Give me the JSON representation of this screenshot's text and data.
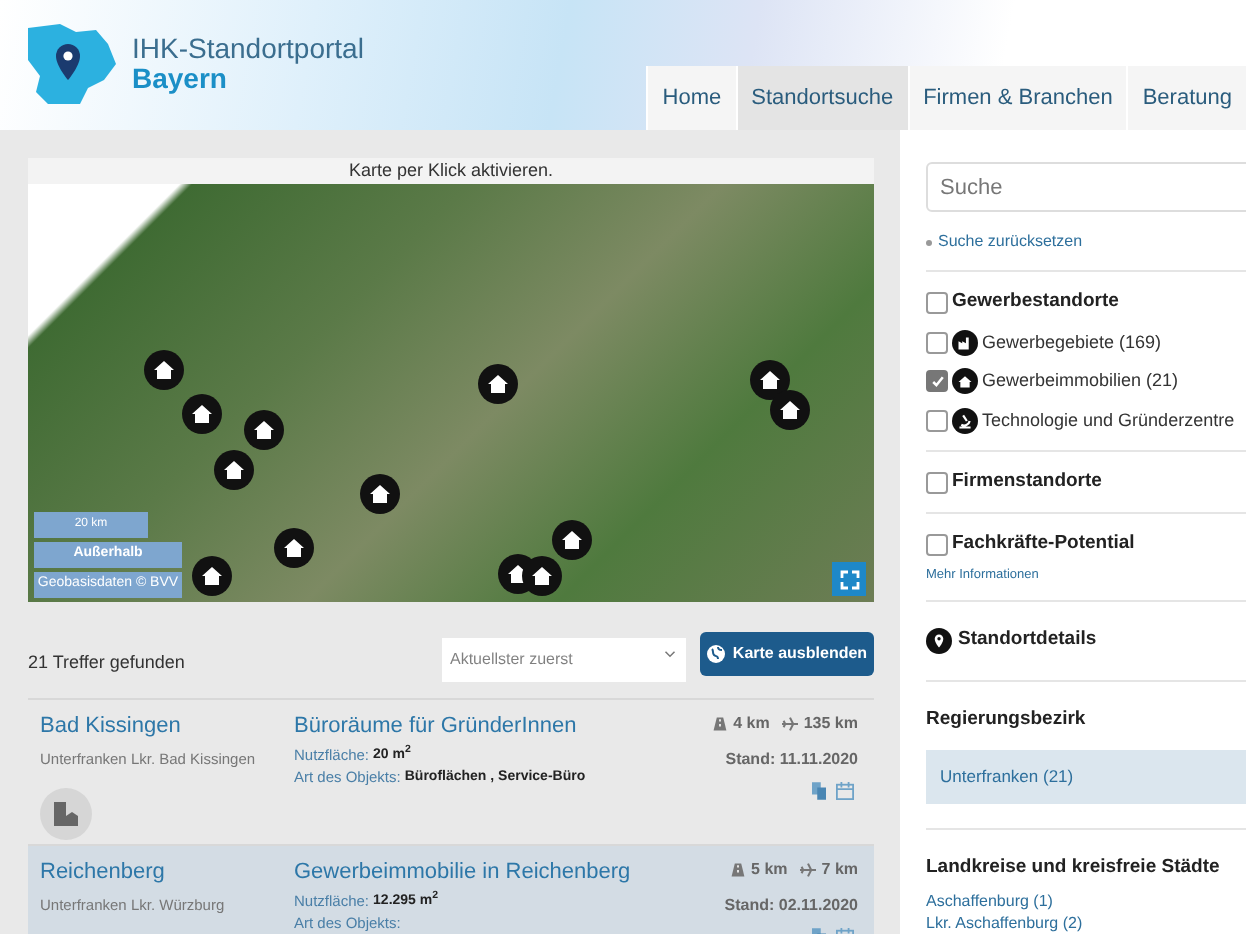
{
  "header": {
    "logo_line1": "IHK-Standortportal",
    "logo_line2": "Bayern"
  },
  "nav": [
    {
      "label": "Home",
      "selected": false
    },
    {
      "label": "Standortsuche",
      "selected": true
    },
    {
      "label": "Firmen & Branchen",
      "selected": false
    },
    {
      "label": "Beratung",
      "selected": false
    }
  ],
  "map": {
    "banner": "Karte per Klick aktivieren.",
    "scale": "20 km",
    "outside_button": "Außerhalb",
    "attribution": "Geobasisdaten © BVV"
  },
  "results": {
    "count": "21 Treffer gefunden",
    "sort_placeholder": "Aktuellster zuerst",
    "hide_map_button": "Karte ausblenden",
    "items": [
      {
        "place": "Bad Kissingen",
        "region": "Unterfranken Lkr. Bad Kissingen",
        "title": "Büroräume für GründerInnen",
        "fields": [
          {
            "label": "Nutzfläche:",
            "value": "20 m$^{2}$"
          },
          {
            "label": "Art des Objekts:",
            "value": "Büroflächen , Service-Büro"
          }
        ],
        "road": "4 km",
        "air": "135 km",
        "stand": "Stand: 11.11.2020",
        "selected": false
      },
      {
        "place": "Reichenberg",
        "region": "Unterfranken Lkr. Würzburg",
        "title": "Gewerbeimmobilie in Reichenberg",
        "fields": [
          {
            "label": "Nutzfläche:",
            "value": "12.295 m$^{2}$"
          },
          {
            "label": "Art des Objekts:"
          }
        ],
        "road": "5 km",
        "air": "7 km",
        "stand": "Stand: 02.11.2020",
        "selected": true
      }
    ]
  },
  "sidebar": {
    "search_placeholder": "Suche",
    "reset_link": "Suche zurücksetzen",
    "groups": [
      {
        "label": "Gewerbestandorte",
        "checked": false,
        "children": [
          {
            "kind": "area",
            "label": "Gewerbegebiete (169)",
            "checked": false
          },
          {
            "kind": "building",
            "label": "Gewerbeimmobilien (21)",
            "checked": true
          },
          {
            "kind": "tech",
            "label": "Technologie und Gründerzentre",
            "checked": false
          }
        ]
      },
      {
        "label": "Firmenstandorte",
        "checked": false
      },
      {
        "label": "Fachkräfte-Potential",
        "checked": false,
        "link": "Mehr Informationen"
      }
    ],
    "details_heading": "Standortdetails",
    "district_heading": "Regierungsbezirk",
    "districts": [
      {
        "label": "Unterfranken (21)",
        "selected": true
      }
    ],
    "counties_heading": "Landkreise und kreisfreie Städte",
    "counties": [
      "Aschaffenburg (1)",
      "Lkr. Aschaffenburg (2)"
    ]
  }
}
